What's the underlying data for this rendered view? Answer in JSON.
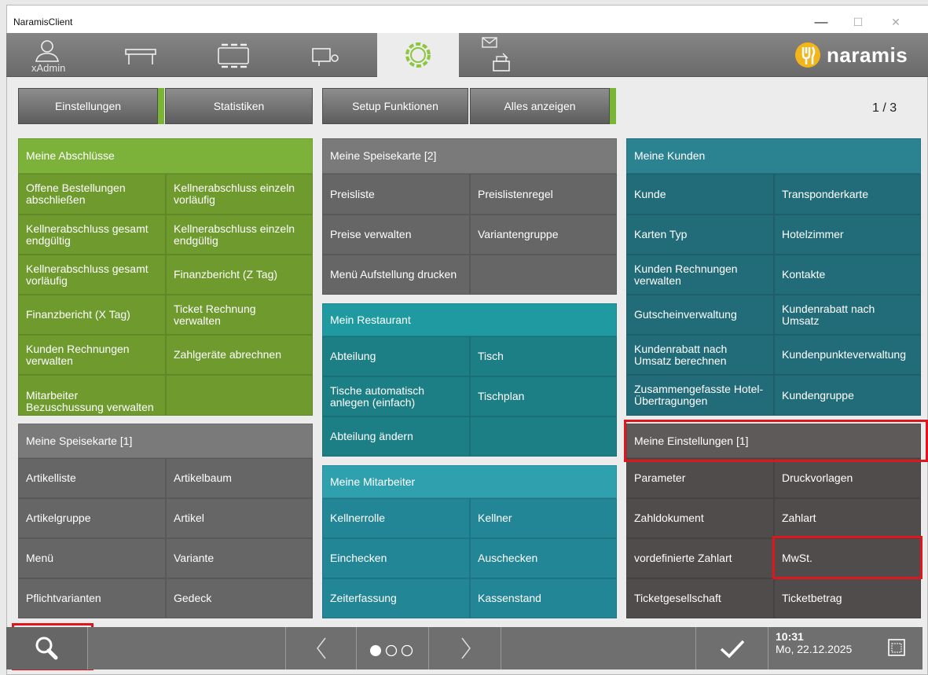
{
  "window": {
    "title": "NaramisClient",
    "minimize": "—",
    "maximize": "☐",
    "close": "✕"
  },
  "topbar": {
    "xadmin_label": "xAdmin",
    "logo_text": "naramis"
  },
  "tabs": [
    "Einstellungen",
    "Statistiken",
    "Setup Funktionen",
    "Alles anzeigen"
  ],
  "page_indicator": "1 / 3",
  "colors": {
    "green": "#6e9a2e",
    "green_header": "#7db23a",
    "gray_tile": "#666666",
    "gray_header": "#7a7a7a",
    "teal": "#1d7f86",
    "teal_header": "#1f9aa1",
    "petrol": "#226c79",
    "petrol_header": "#2b8391",
    "blue_teal": "#238696",
    "blue_teal_header": "#2fa0ae",
    "dark_tile": "#4f4c4b",
    "highlight": "#e0161c"
  },
  "groups": {
    "abschluesse": {
      "header": "Meine Abschlüsse",
      "items": [
        "Offene Bestellungen abschließen",
        "Kellnerabschluss einzeln vorläufig",
        "Kellnerabschluss gesamt endgültig",
        "Kellnerabschluss einzeln endgültig",
        "Kellnerabschluss gesamt vorläufig",
        "Finanzbericht (Z Tag)",
        "Finanzbericht (X Tag)",
        "Ticket Rechnung verwalten",
        "Kunden Rechnungen verwalten",
        "Zahlgeräte abrechnen",
        "Mitarbeiter Bezuschussung verwalten",
        ""
      ]
    },
    "speisekarte1": {
      "header": "Meine Speisekarte [1]",
      "items": [
        "Artikelliste",
        "Artikelbaum",
        "Artikelgruppe",
        "Artikel",
        "Menü",
        "Variante",
        "Pflichtvarianten",
        "Gedeck"
      ]
    },
    "speisekarte2": {
      "header": "Meine Speisekarte [2]",
      "items": [
        "Preisliste",
        "Preislistenregel",
        "Preise verwalten",
        "Variantengruppe",
        "Menü Aufstellung drucken",
        ""
      ]
    },
    "restaurant": {
      "header": "Mein Restaurant",
      "items": [
        "Abteilung",
        "Tisch",
        "Tische automatisch anlegen (einfach)",
        "Tischplan",
        "Abteilung ändern",
        ""
      ]
    },
    "mitarbeiter": {
      "header": "Meine Mitarbeiter",
      "items": [
        "Kellnerrolle",
        "Kellner",
        "Einchecken",
        "Auschecken",
        "Zeiterfassung",
        "Kassenstand"
      ]
    },
    "kunden": {
      "header": "Meine Kunden",
      "items": [
        "Kunde",
        "Transponderkarte",
        "Karten Typ",
        "Hotelzimmer",
        "Kunden Rechnungen verwalten",
        "Kontakte",
        "Gutscheinverwaltung",
        "Kundenrabatt nach Umsatz",
        "Kundenrabatt nach Umsatz berechnen",
        "Kundenpunkteverwaltung",
        "Zusammengefasste Hotel- Übertragungen",
        "Kundengruppe"
      ]
    },
    "einstellungen1": {
      "header": "Meine Einstellungen [1]",
      "items": [
        "Parameter",
        "Druckvorlagen",
        "Zahldokument",
        "Zahlart",
        "vordefinierte Zahlart",
        "MwSt.",
        "Ticketgesellschaft",
        "Ticketbetrag"
      ]
    }
  },
  "bottombar": {
    "time": "10:31",
    "date": "Mo, 22.12.2025"
  }
}
